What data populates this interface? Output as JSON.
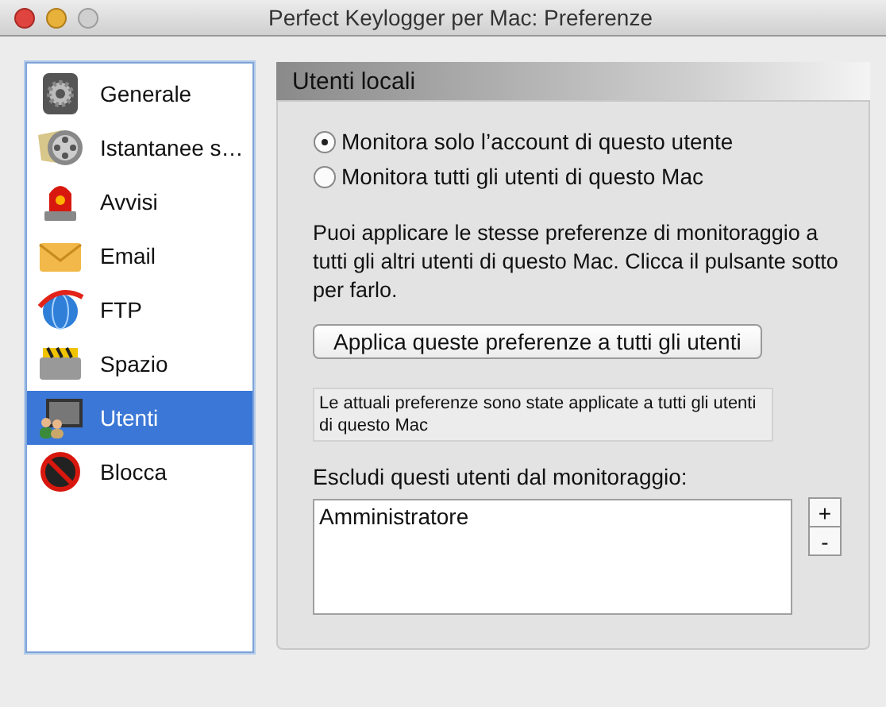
{
  "window": {
    "title": "Perfect Keylogger per Mac: Preferenze"
  },
  "sidebar": {
    "items": [
      {
        "label": "Generale",
        "selected": false
      },
      {
        "label": "Istantanee s…",
        "selected": false
      },
      {
        "label": "Avvisi",
        "selected": false
      },
      {
        "label": "Email",
        "selected": false
      },
      {
        "label": "FTP",
        "selected": false
      },
      {
        "label": "Spazio",
        "selected": false
      },
      {
        "label": "Utenti",
        "selected": true
      },
      {
        "label": "Blocca",
        "selected": false
      }
    ]
  },
  "panel": {
    "title": "Utenti locali",
    "options": [
      {
        "label": "Monitora solo l’account di questo utente",
        "selected": true
      },
      {
        "label": "Monitora tutti gli utenti di questo Mac",
        "selected": false
      }
    ],
    "description": "Puoi applicare le stesse preferenze di monitoraggio a tutti gli altri utenti di questo Mac. Clicca il pulsante sotto per farlo.",
    "apply_button": "Applica queste preferenze a tutti gli utenti",
    "status_message": "Le attuali preferenze sono state applicate a tutti gli utenti di questo Mac",
    "exclude_label": "Escludi questi utenti dal monitoraggio:",
    "excluded_users": [
      "Amministratore"
    ],
    "add_button": "+",
    "remove_button": "-"
  }
}
